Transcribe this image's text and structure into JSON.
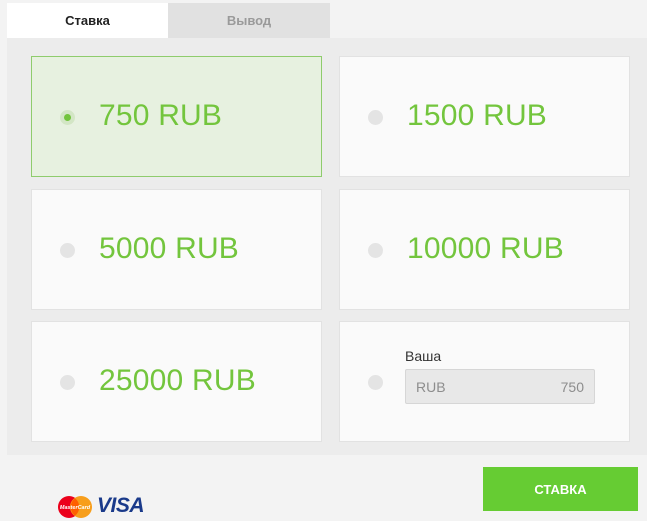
{
  "tabs": [
    {
      "label": "Ставка",
      "active": true
    },
    {
      "label": "Вывод",
      "active": false
    }
  ],
  "options": [
    {
      "amount": "750 RUB",
      "selected": true
    },
    {
      "amount": "1500 RUB",
      "selected": false
    },
    {
      "amount": "5000 RUB",
      "selected": false
    },
    {
      "amount": "10000 RUB",
      "selected": false
    },
    {
      "amount": "25000 RUB",
      "selected": false
    }
  ],
  "custom": {
    "label": "Ваша сумма:",
    "currency": "RUB",
    "value": "750"
  },
  "payment": {
    "mastercard_text": "MasterCard",
    "visa_text": "VISA"
  },
  "submit_label": "СТАВКА",
  "colors": {
    "accent": "#66cc33",
    "amount_text": "#73c53d",
    "selected_bg": "#e7f1e0"
  }
}
